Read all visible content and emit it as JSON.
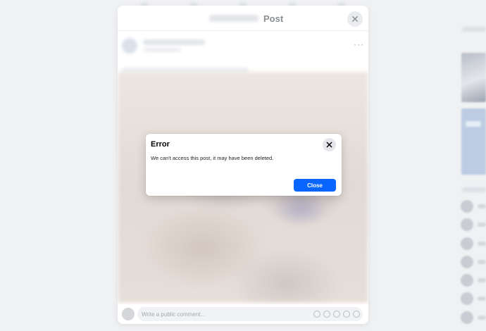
{
  "post_modal": {
    "title": "Post",
    "close_glyph": "✕",
    "more_glyph": "···",
    "comment_placeholder": "Write a public comment..."
  },
  "error_dialog": {
    "title": "Error",
    "message": "We can't access this post, it may have been deleted.",
    "close_button_label": "Close",
    "close_icon": "close-icon"
  },
  "colors": {
    "primary_button": "#0866ff",
    "overlay_background": "#f0f1f3"
  }
}
